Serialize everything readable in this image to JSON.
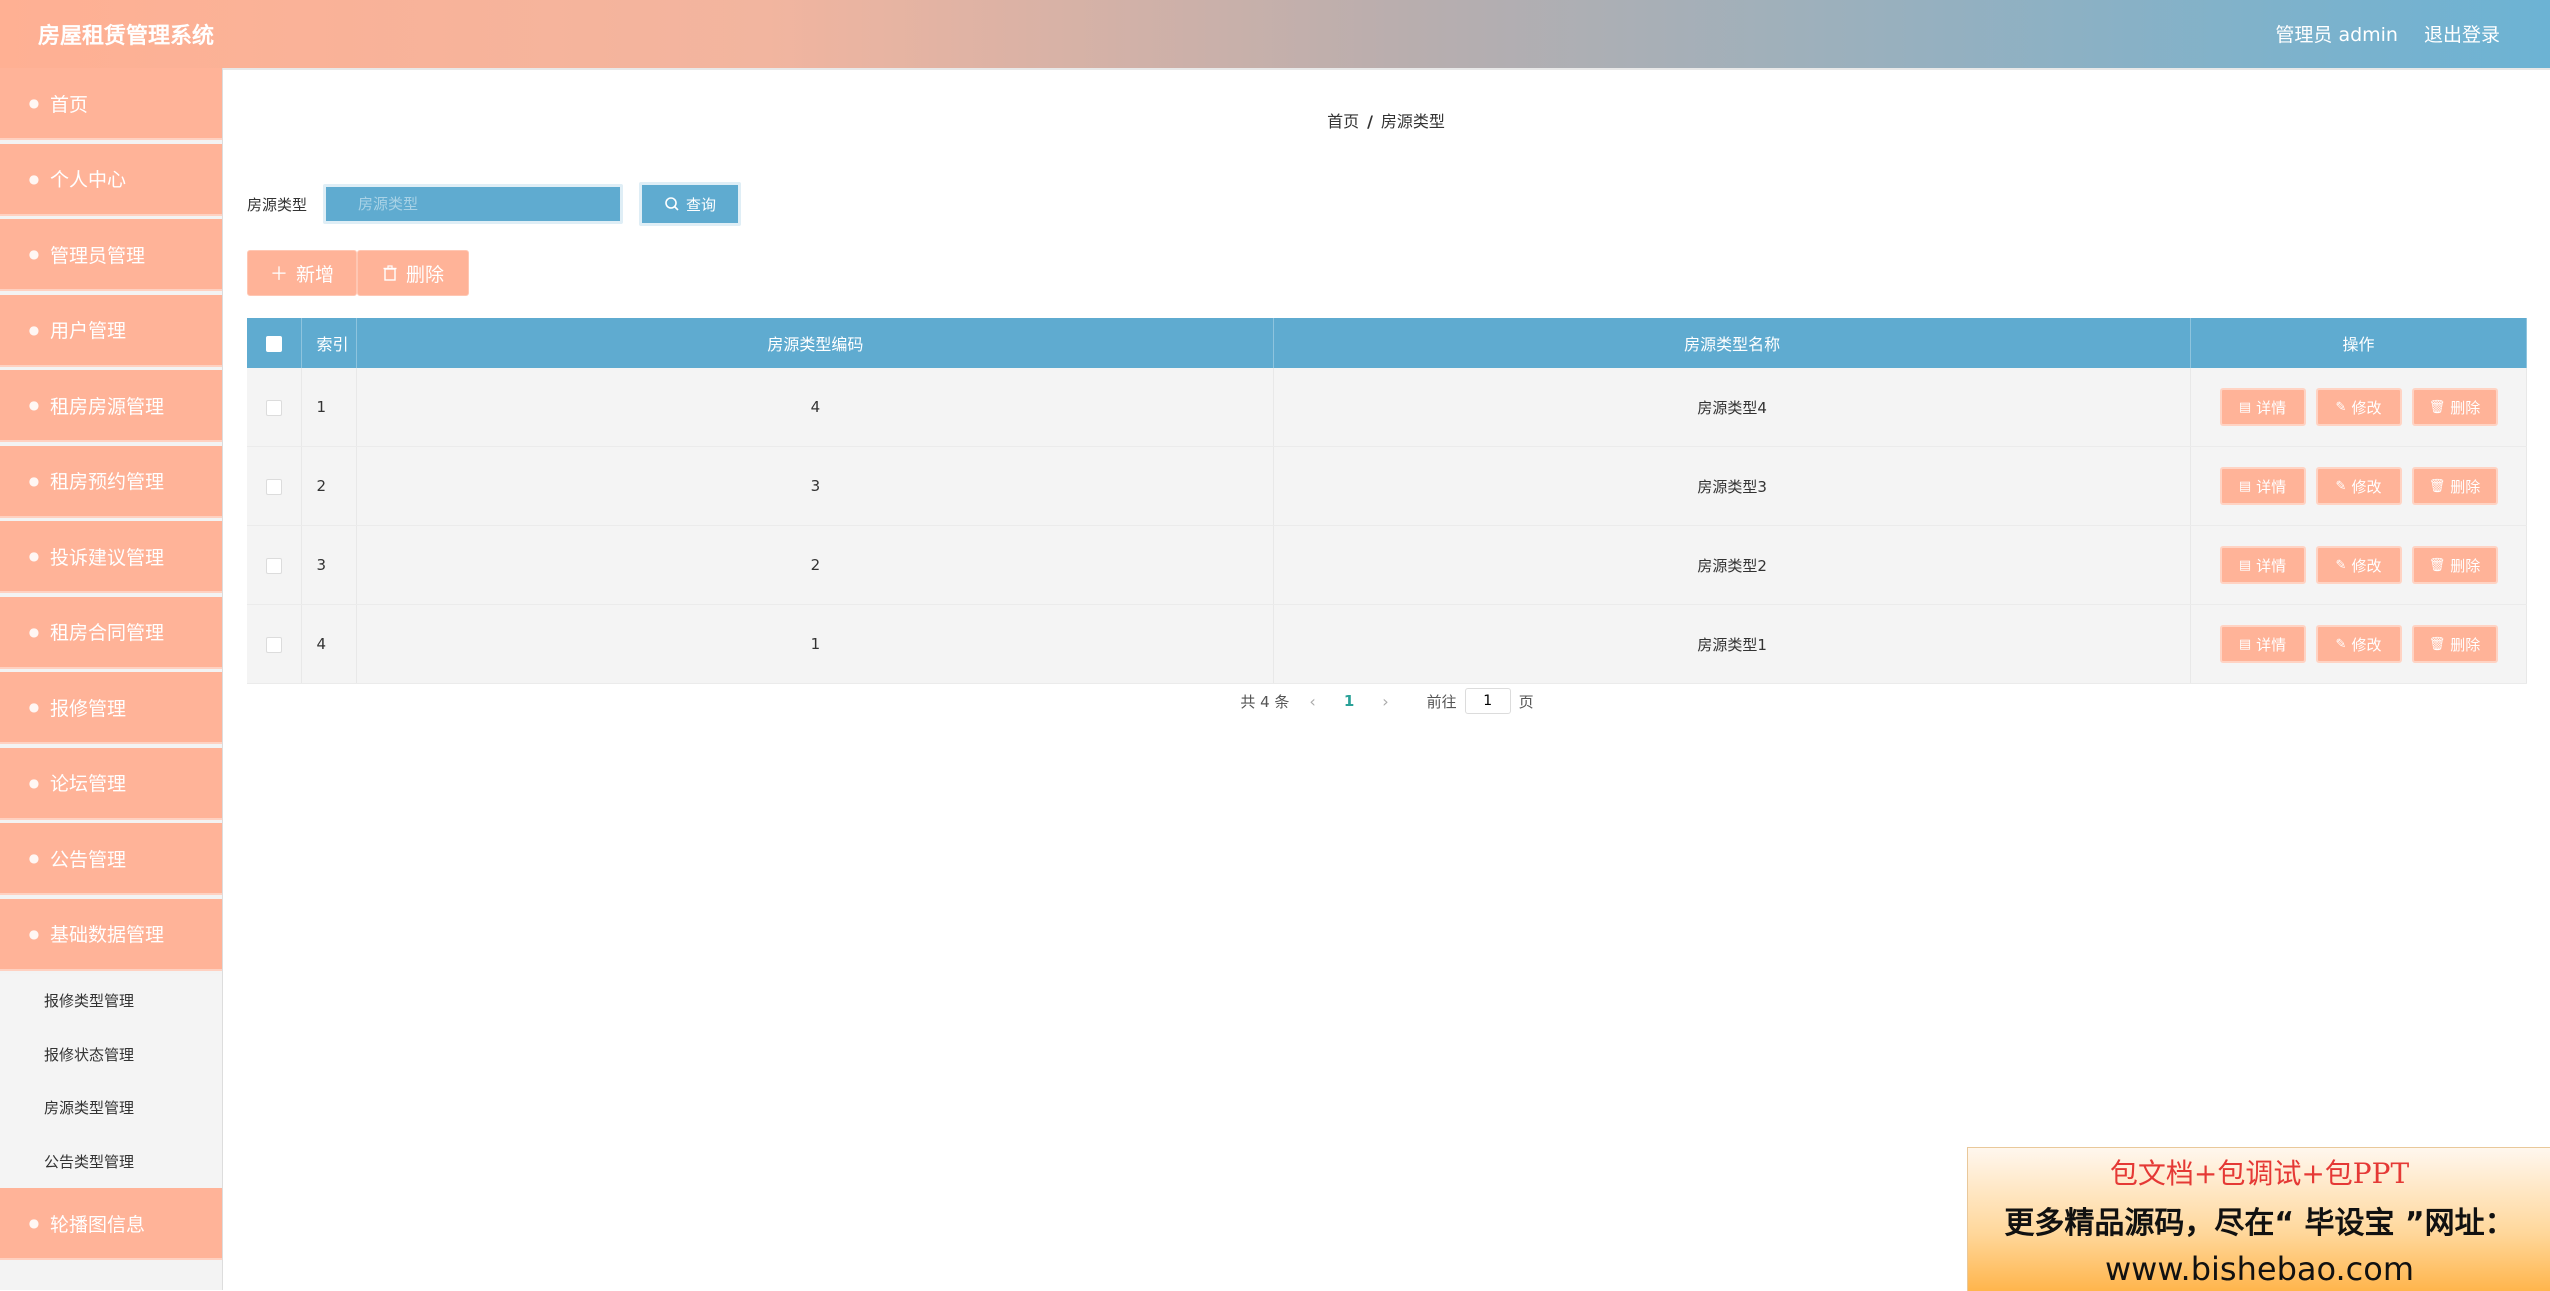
{
  "header": {
    "app_title": "房屋租赁管理系统",
    "user_label": "管理员 admin",
    "logout_label": "退出登录"
  },
  "sidebar": {
    "items": [
      {
        "label": "首页",
        "icon": "home-icon"
      },
      {
        "label": "个人中心",
        "icon": "user-icon"
      },
      {
        "label": "管理员管理",
        "icon": "admin-icon"
      },
      {
        "label": "用户管理",
        "icon": "users-icon"
      },
      {
        "label": "租房房源管理",
        "icon": "house-icon"
      },
      {
        "label": "租房预约管理",
        "icon": "calendar-icon"
      },
      {
        "label": "投诉建议管理",
        "icon": "feedback-icon"
      },
      {
        "label": "租房合同管理",
        "icon": "contract-icon"
      },
      {
        "label": "报修管理",
        "icon": "repair-icon"
      },
      {
        "label": "论坛管理",
        "icon": "forum-icon"
      },
      {
        "label": "公告管理",
        "icon": "notice-icon"
      },
      {
        "label": "基础数据管理",
        "icon": "data-icon"
      }
    ],
    "subitems": [
      {
        "label": "报修类型管理"
      },
      {
        "label": "报修状态管理"
      },
      {
        "label": "房源类型管理"
      },
      {
        "label": "公告类型管理"
      }
    ],
    "items_after": [
      {
        "label": "轮播图信息",
        "icon": "image-icon"
      }
    ]
  },
  "breadcrumb": {
    "home": "首页",
    "separator": "/",
    "current": "房源类型"
  },
  "search": {
    "label": "房源类型",
    "placeholder": "房源类型",
    "value": "",
    "button_label": "查询"
  },
  "actions": {
    "add_label": "新增",
    "delete_label": "删除"
  },
  "table": {
    "columns": [
      "索引",
      "房源类型编码",
      "房源类型名称",
      "操作"
    ],
    "rows": [
      {
        "index": "1",
        "code": "4",
        "name": "房源类型4"
      },
      {
        "index": "2",
        "code": "3",
        "name": "房源类型3"
      },
      {
        "index": "3",
        "code": "2",
        "name": "房源类型2"
      },
      {
        "index": "4",
        "code": "1",
        "name": "房源类型1"
      }
    ],
    "row_actions": {
      "detail": "详情",
      "edit": "修改",
      "delete": "删除"
    }
  },
  "pagination": {
    "total_text": "共 4 条",
    "current_page": "1",
    "goto_label": "前往",
    "goto_value": "1",
    "page_suffix": "页"
  },
  "ad": {
    "line1": "包文档+包调试+包PPT",
    "line2": "更多精品源码，尽在“ 毕设宝 ”网址：",
    "line3": "www.bishebao.com"
  },
  "colors": {
    "accent_orange": "#ffb398",
    "accent_blue": "#5fabd0"
  }
}
